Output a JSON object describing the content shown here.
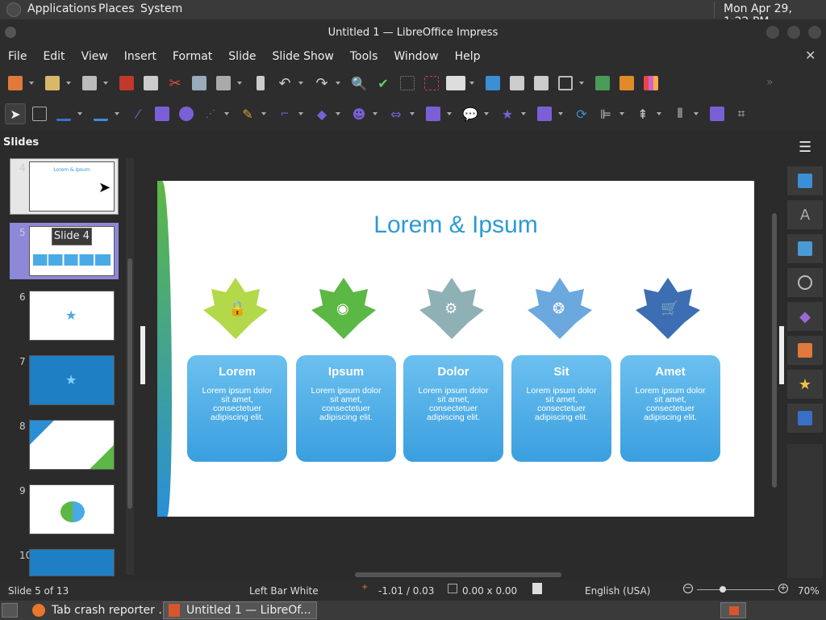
{
  "gnome_panel": {
    "applications": "Applications",
    "places": "Places",
    "system": "System",
    "clock": "Mon Apr 29,  1:22 PM"
  },
  "window": {
    "title": "Untitled 1 — LibreOffice Impress"
  },
  "menu": [
    "File",
    "Edit",
    "View",
    "Insert",
    "Format",
    "Slide",
    "Slide Show",
    "Tools",
    "Window",
    "Help"
  ],
  "slides_panel": {
    "title": "Slides",
    "numbers": [
      "4",
      "5",
      "6",
      "7",
      "8",
      "9",
      "10"
    ],
    "tooltip": "Slide 4",
    "thumb_title": "Lorem & Ipsum"
  },
  "slide": {
    "title": "Lorem & Ipsum",
    "cards": [
      {
        "title": "Lorem",
        "body": "Lorem ipsum dolor sit amet, consectetuer adipiscing elit.",
        "color": "#b3d94a",
        "icon": "lock-icon"
      },
      {
        "title": "Ipsum",
        "body": "Lorem ipsum dolor sit amet, consectetuer adipiscing elit.",
        "color": "#5cb845",
        "icon": "rss-icon"
      },
      {
        "title": "Dolor",
        "body": "Lorem ipsum dolor sit amet, consectetuer adipiscing elit.",
        "color": "#8fb0b4",
        "icon": "gear-icon"
      },
      {
        "title": "Sit",
        "body": "Lorem ipsum dolor sit amet, consectetuer adipiscing elit.",
        "color": "#6aa8dd",
        "icon": "film-reel-icon"
      },
      {
        "title": "Amet",
        "body": "Lorem ipsum dolor sit amet, consectetuer adipiscing elit.",
        "color": "#3d6db3",
        "icon": "cart-icon"
      }
    ],
    "title_color": "#2a9ad6",
    "card_color": "#4aaae6"
  },
  "status": {
    "slide": "Slide 5 of 13",
    "layout": "Left Bar White",
    "position": "-1.01 / 0.03",
    "size": "0.00 x 0.00",
    "language": "English (USA)",
    "zoom": "70%"
  },
  "taskbar": {
    "task1": "Tab crash reporter ...",
    "task2": "Untitled 1 — LibreOf..."
  }
}
